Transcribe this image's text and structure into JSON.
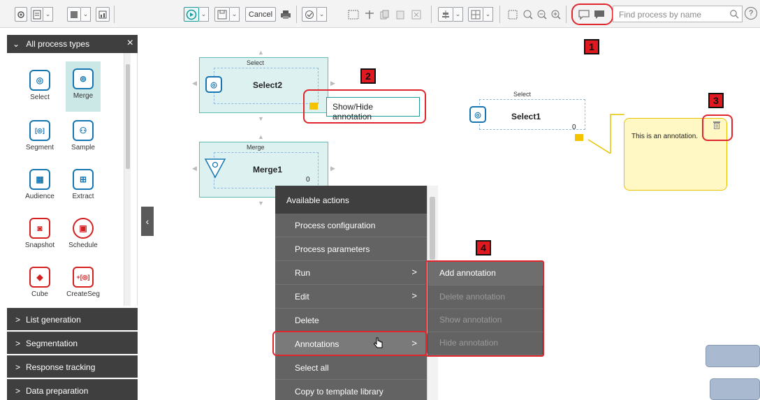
{
  "toolbar": {
    "cancel_label": "Cancel",
    "search_placeholder": "Find process by name",
    "help_label": "?"
  },
  "callouts": [
    "1",
    "2",
    "3",
    "4"
  ],
  "palette": {
    "header": "All process types",
    "close": "×",
    "items": [
      {
        "label": "Select",
        "icon": "select-icon",
        "glyph": "◎"
      },
      {
        "label": "Merge",
        "icon": "merge-icon",
        "glyph": "⊚"
      },
      {
        "label": "Segment",
        "icon": "segment-icon",
        "glyph": "[◎]"
      },
      {
        "label": "Sample",
        "icon": "sample-icon",
        "glyph": "⚇"
      },
      {
        "label": "Audience",
        "icon": "audience-icon",
        "glyph": "▦"
      },
      {
        "label": "Extract",
        "icon": "extract-icon",
        "glyph": "⊞"
      },
      {
        "label": "Snapshot",
        "icon": "snapshot-icon",
        "glyph": "◙"
      },
      {
        "label": "Schedule",
        "icon": "schedule-icon",
        "glyph": "▣"
      },
      {
        "label": "Cube",
        "icon": "cube-icon",
        "glyph": "◆"
      },
      {
        "label": "CreateSeg",
        "icon": "createseg-icon",
        "glyph": "+[◎]"
      }
    ],
    "sections": [
      "List generation",
      "Segmentation",
      "Response tracking",
      "Data preparation"
    ],
    "selected": "Merge"
  },
  "canvas": {
    "nodes": [
      {
        "type": "Select",
        "title": "Select2",
        "count": "0"
      },
      {
        "type": "Merge",
        "title": "Merge1",
        "count": "0"
      },
      {
        "type": "Select",
        "title": "Select1",
        "count": "0"
      }
    ],
    "tooltip": "Show/Hide annotation",
    "annotation_text": "This is an annotation."
  },
  "context_menu": {
    "title": "Available actions",
    "items": [
      {
        "label": "Process configuration",
        "submenu": false
      },
      {
        "label": "Process parameters",
        "submenu": false
      },
      {
        "label": "Run",
        "submenu": true
      },
      {
        "label": "Edit",
        "submenu": true
      },
      {
        "label": "Delete",
        "submenu": false
      },
      {
        "label": "Annotations",
        "submenu": true
      },
      {
        "label": "Select all",
        "submenu": false
      },
      {
        "label": "Copy to template library",
        "submenu": false
      }
    ],
    "highlighted": "Annotations",
    "submenu": [
      {
        "label": "Add annotation",
        "enabled": true
      },
      {
        "label": "Delete annotation",
        "enabled": false
      },
      {
        "label": "Show annotation",
        "enabled": false
      },
      {
        "label": "Hide annotation",
        "enabled": false
      }
    ]
  },
  "colors": {
    "accent": "#1c9aa0",
    "node_fill": "#dcf1f0",
    "annotation_fill": "#fff7c4",
    "highlight": "#e0262c",
    "menu_bg": "#636363"
  }
}
